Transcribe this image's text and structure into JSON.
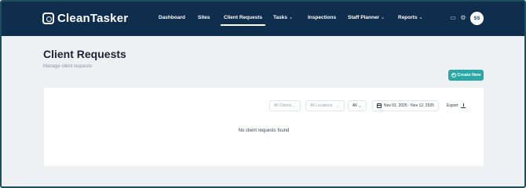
{
  "app": {
    "name": "CleanTasker",
    "logo_icon": "broom-badge-icon"
  },
  "nav": {
    "items": [
      {
        "label": "Dashboard",
        "active": false,
        "dropdown": false
      },
      {
        "label": "Sites",
        "active": false,
        "dropdown": false
      },
      {
        "label": "Client Requests",
        "active": true,
        "dropdown": false
      },
      {
        "label": "Tasks",
        "active": false,
        "dropdown": true
      },
      {
        "label": "Inspections",
        "active": false,
        "dropdown": false
      },
      {
        "label": "Staff Planner",
        "active": false,
        "dropdown": true
      },
      {
        "label": "Reports",
        "active": false,
        "dropdown": true
      }
    ]
  },
  "topbar_right": {
    "inbox_icon": "inbox-icon",
    "settings_icon": "gear-icon",
    "avatar_initials": "SS"
  },
  "page": {
    "title": "Client Requests",
    "subtitle": "Manage client requests",
    "create_button": "Create New"
  },
  "filters": {
    "clients_placeholder": "All Clients",
    "locations_placeholder": "All Locations",
    "status_value": "All",
    "date_range": "Nov 01, 2025 - Nov 12, 2025",
    "export_label": "Export"
  },
  "empty_message": "No client requests found",
  "colors": {
    "topbar": "#0f2d4d",
    "accent": "#2aa8a6",
    "background": "#eef1f4"
  }
}
